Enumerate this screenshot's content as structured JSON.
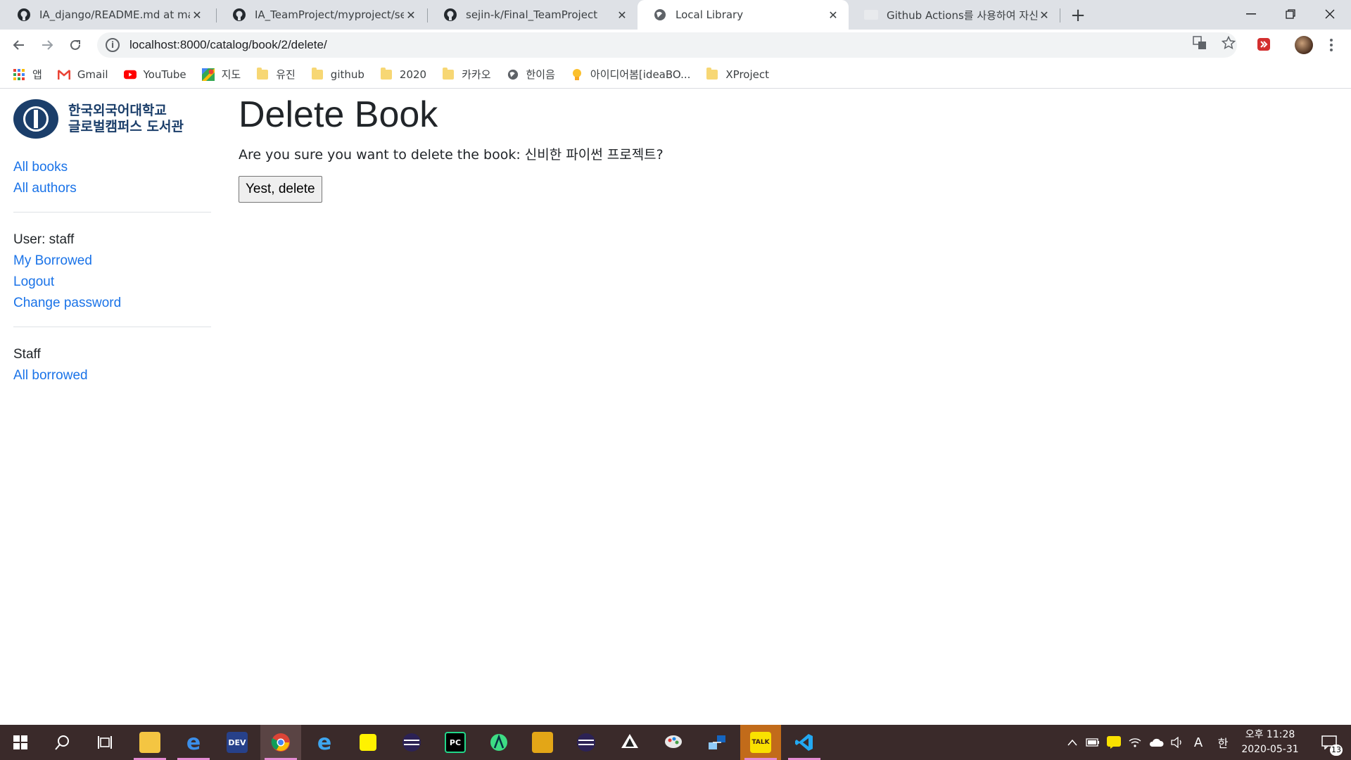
{
  "browser": {
    "tabs": [
      {
        "title": "IA_django/README.md at master",
        "icon": "github-icon",
        "active": false
      },
      {
        "title": "IA_TeamProject/myproject/search",
        "icon": "github-icon",
        "active": false
      },
      {
        "title": "sejin-k/Final_TeamProject",
        "icon": "github-icon",
        "active": false
      },
      {
        "title": "Local Library",
        "icon": "globe-icon",
        "active": true
      },
      {
        "title": "Github Actions를 사용하여 자신",
        "icon": "site-icon",
        "active": false
      }
    ],
    "new_tab": "+",
    "url": "localhost:8000/catalog/book/2/delete/",
    "bookmarks": [
      {
        "label": "앱",
        "icon": "apps-grid-icon"
      },
      {
        "label": "Gmail",
        "icon": "gmail-icon"
      },
      {
        "label": "YouTube",
        "icon": "youtube-icon"
      },
      {
        "label": "지도",
        "icon": "maps-icon"
      },
      {
        "label": "유진",
        "icon": "folder-icon"
      },
      {
        "label": "github",
        "icon": "folder-icon"
      },
      {
        "label": "2020",
        "icon": "folder-icon"
      },
      {
        "label": "카카오",
        "icon": "folder-icon"
      },
      {
        "label": "한이음",
        "icon": "globe-icon"
      },
      {
        "label": "아이디어봄[ideaBO...",
        "icon": "lightbulb-icon"
      },
      {
        "label": "XProject",
        "icon": "folder-icon"
      }
    ]
  },
  "site": {
    "logo_line1": "한국외국어대학교",
    "logo_line2": "글로벌캠퍼스 도서관",
    "nav": {
      "all_books": "All books",
      "all_authors": "All authors"
    },
    "user": {
      "label": "User: staff",
      "my_borrowed": "My Borrowed",
      "logout": "Logout",
      "change_password": "Change password"
    },
    "staff": {
      "label": "Staff",
      "all_borrowed": "All borrowed"
    }
  },
  "main": {
    "title": "Delete Book",
    "confirm_text": "Are you sure you want to delete the book: 신비한 파이썬 프로젝트?",
    "delete_button": "Yest, delete"
  },
  "taskbar": {
    "clock_time": "오후 11:28",
    "clock_date": "2020-05-31",
    "ime_lang": "A",
    "ime_mode": "한",
    "notifications": "13"
  }
}
